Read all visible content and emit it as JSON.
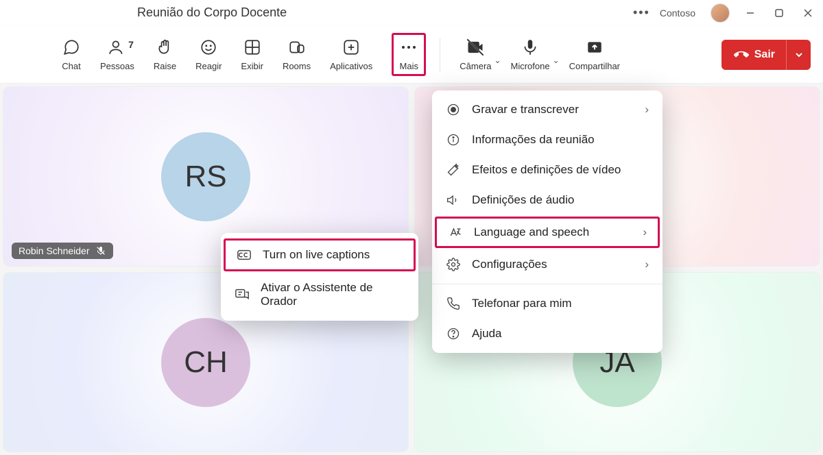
{
  "title": "Reunião do Corpo Docente",
  "org": "Contoso",
  "toolbar": {
    "chat": "Chat",
    "people": "Pessoas",
    "people_count": "7",
    "raise": "Raise",
    "react": "Reagir",
    "view": "Exibir",
    "rooms": "Rooms",
    "apps": "Aplicativos",
    "more": "Mais",
    "camera": "Câmera",
    "mic": "Microfone",
    "share": "Compartilhar",
    "leave": "Sair"
  },
  "participants": {
    "p1_initials": "RS",
    "p1_name": "Robin Schneider",
    "p3_initials": "CH",
    "p4_initials": "JA"
  },
  "menu": {
    "record": "Gravar e transcrever",
    "info": "Informações da reunião",
    "video_fx": "Efeitos e definições de vídeo",
    "audio": "Definições de áudio",
    "language": "Language and speech",
    "settings": "Configurações",
    "callme": "Telefonar para mim",
    "help": "Ajuda"
  },
  "submenu": {
    "captions": "Turn on live captions",
    "coach": "Ativar o Assistente de Orador"
  }
}
